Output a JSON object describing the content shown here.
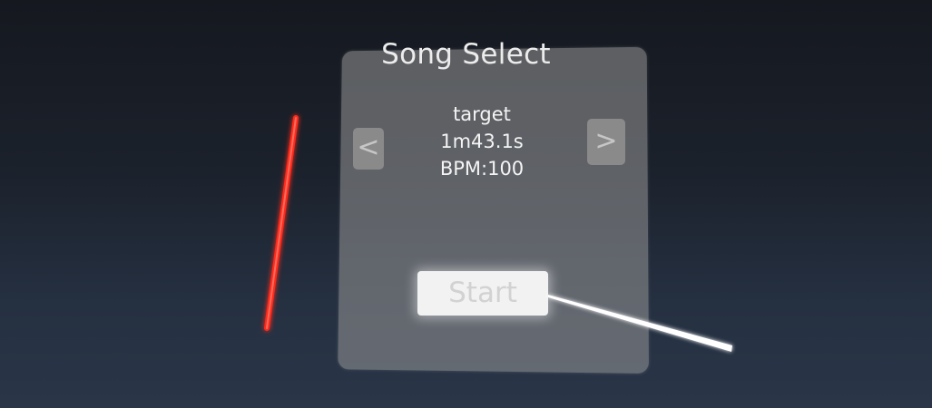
{
  "panel": {
    "title": "Song Select",
    "prev_label": "<",
    "next_label": ">",
    "start_label": "Start"
  },
  "song": {
    "name": "target",
    "duration": "1m43.1s",
    "bpm": "BPM:100"
  },
  "colors": {
    "left_saber": "#ff2a1a",
    "right_pointer": "#ffffff"
  }
}
